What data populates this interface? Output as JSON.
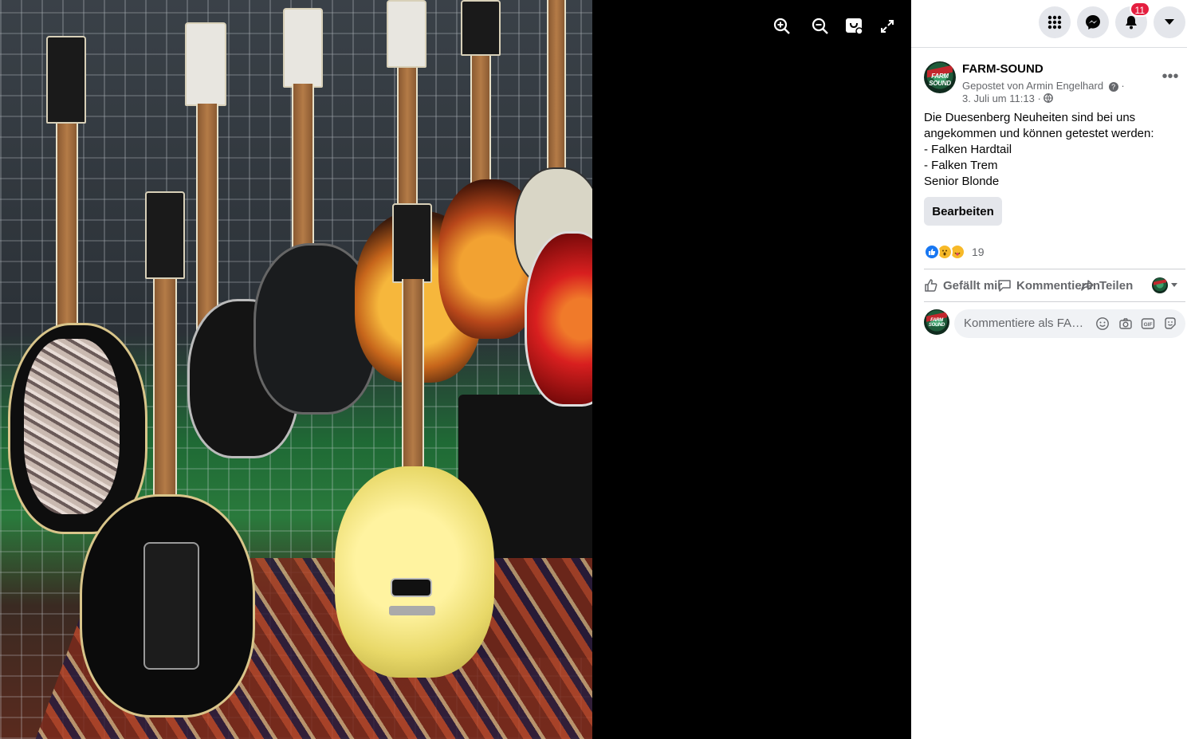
{
  "viewer": {
    "toolbar": [
      {
        "icon": "zoom-in-icon"
      },
      {
        "icon": "zoom-out-icon"
      },
      {
        "icon": "tag-icon"
      },
      {
        "icon": "fullscreen-icon"
      }
    ]
  },
  "topbar": {
    "menu_icon": "grid-menu-icon",
    "messenger_icon": "messenger-icon",
    "notifications_icon": "bell-icon",
    "notifications_count": "11",
    "account_icon": "caret-down-icon"
  },
  "post": {
    "page_name": "FARM-SOUND",
    "avatar_text": "FARM SOUND",
    "posted_by": "Gepostet von Armin Engelhard",
    "date": "3. Juli um 11:13",
    "more_label": "•••",
    "text_lines": [
      "Die Duesenberg Neuheiten sind bei uns",
      "angekommen und können getestet werden:",
      "- Falken Hardtail",
      "- Falken Trem",
      "Senior Blonde"
    ],
    "edit_label": "Bearbeiten",
    "reactions": [
      "like",
      "wow",
      "care"
    ],
    "reaction_count": "19",
    "actions": {
      "like": "Gefällt mir",
      "comment": "Kommentieren",
      "share": "Teilen"
    },
    "comment_placeholder": "Kommentiere als FARM-SOUND"
  },
  "colors": {
    "accent": "#1877f2",
    "badge": "#e41e3f",
    "secondary_text": "#65676b"
  }
}
